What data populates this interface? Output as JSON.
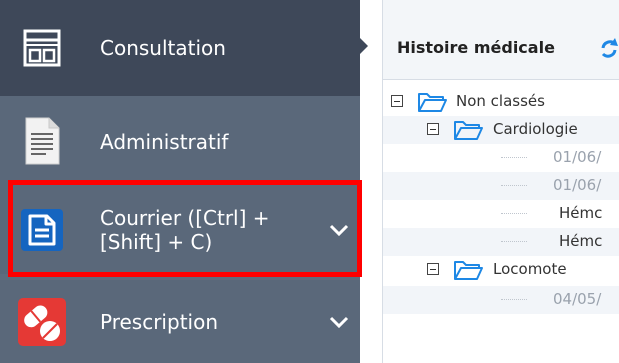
{
  "sidebar": {
    "items": [
      {
        "label": "Consultation",
        "icon": "consultation-icon"
      },
      {
        "label": "Administratif",
        "icon": "document-icon"
      },
      {
        "label": "Courrier ([Ctrl] +\n[Shift] + C)",
        "icon": "letter-icon"
      },
      {
        "label": "Prescription",
        "icon": "pill-icon"
      }
    ]
  },
  "panel": {
    "title": "Histoire médicale",
    "tree": [
      {
        "label": "Non classés"
      },
      {
        "label": "Cardiologie"
      },
      {
        "label": "01/06/"
      },
      {
        "label": "01/06/"
      },
      {
        "label": "Hémc"
      },
      {
        "label": "Hémc"
      },
      {
        "label": "Locomote"
      },
      {
        "label": "04/05/"
      }
    ]
  },
  "colors": {
    "sidebar_active": "#3e4859",
    "sidebar_bg": "#5a687a",
    "highlight": "#ff0000",
    "folder": "#1e88e5",
    "letter_icon": "#1565c0",
    "pill_icon": "#e53935"
  }
}
